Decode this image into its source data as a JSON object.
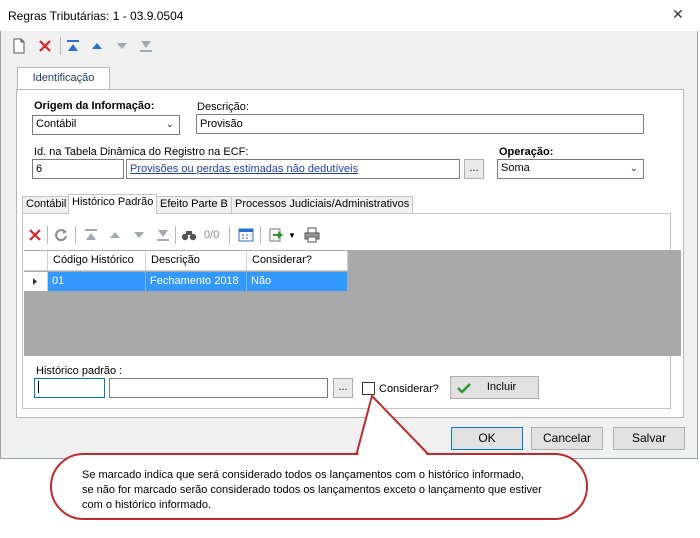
{
  "window": {
    "title": "Regras Tributárias: 1 - 03.9.0504"
  },
  "toolbar": {
    "icons": [
      "new-document-icon",
      "delete-icon",
      "move-first-icon",
      "move-up-icon",
      "move-down-icon",
      "move-last-icon"
    ]
  },
  "main_tab": {
    "label": "Identificação"
  },
  "form": {
    "origem_label": "Origem da Informação:",
    "origem_value": "Contábil",
    "descricao_label": "Descrição:",
    "descricao_value": "Provisão",
    "id_label": "Id. na Tabela Dinâmica do Registro na ECF:",
    "id_value": "6",
    "id_link": "Provisões ou perdas estimadas não dedutíveis",
    "ellipsis": "...",
    "operacao_label": "Operação:",
    "operacao_value": "Soma"
  },
  "subtabs": [
    "Contábil",
    "Histórico Padrão",
    "Efeito Parte B",
    "Processos Judiciais/Administrativos"
  ],
  "grid_toolbar": {
    "counter": "0/0"
  },
  "grid": {
    "columns": [
      "Código Histórico",
      "Descrição",
      "Considerar?"
    ],
    "rows": [
      {
        "codigo": "01",
        "descricao": "Fechamento 2018",
        "considerar": "Não"
      }
    ]
  },
  "historico": {
    "label": "Histórico padrão :",
    "ellipsis": "...",
    "considerar_label": "Considerar?",
    "incluir_label": "Incluir"
  },
  "footer": {
    "ok": "OK",
    "cancelar": "Cancelar",
    "salvar": "Salvar"
  },
  "callout": {
    "line1": "Se marcado indica que será considerado todos os lançamentos com o histórico informado,",
    "line2": "se não for marcado serão considerado todos os lançamentos exceto o lançamento que estiver",
    "line3": "com o histórico informado."
  },
  "colors": {
    "selection": "#3399ff",
    "callout_border": "#c02a2a",
    "link": "#1f3fae"
  }
}
